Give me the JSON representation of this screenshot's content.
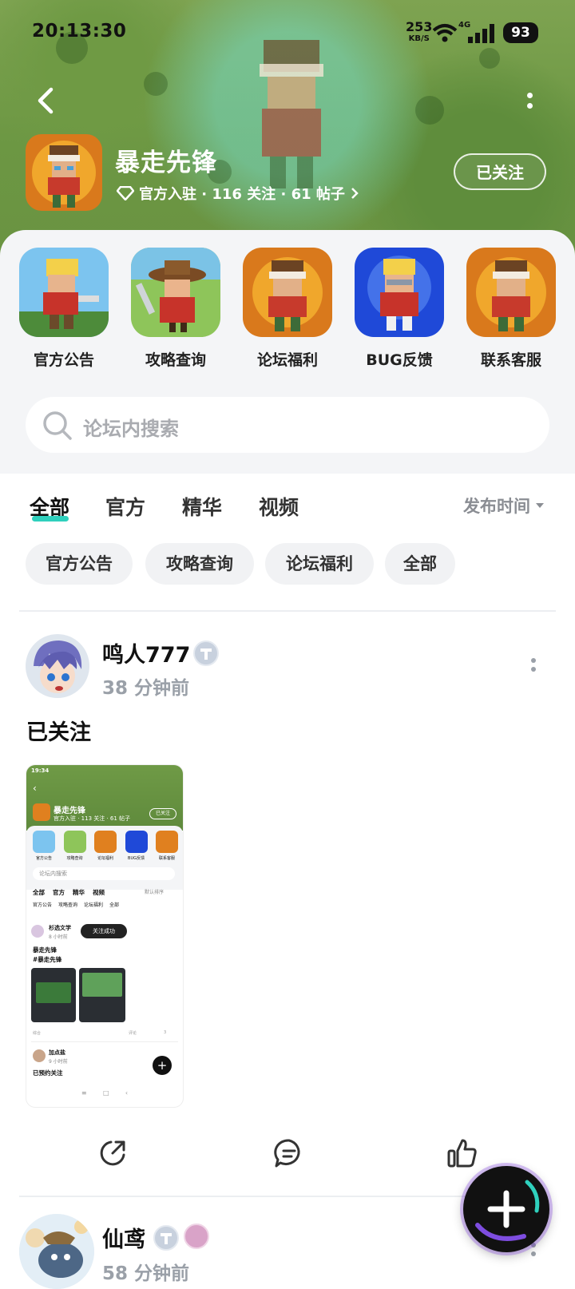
{
  "status_bar": {
    "time": "20:13:30",
    "net_speed_value": "253",
    "net_speed_unit": "KB/S",
    "network": "4G",
    "battery": "93"
  },
  "header": {
    "game_title": "暴走先锋",
    "meta_text": "官方入驻 · 116 关注 · 61 帖子",
    "follow_label": "已关注",
    "icons": {
      "back": "back-arrow-icon",
      "more": "vertical-dots-icon",
      "verified": "diamond-icon"
    }
  },
  "shortcuts": [
    {
      "label": "官方公告",
      "color": "#3aa0e0"
    },
    {
      "label": "攻略查询",
      "color": "#8cc056"
    },
    {
      "label": "论坛福利",
      "color": "#e07a1e"
    },
    {
      "label": "BUG反馈",
      "color": "#1f49d8"
    },
    {
      "label": "联系客服",
      "color": "#e07a1e"
    }
  ],
  "search": {
    "placeholder": "论坛内搜索"
  },
  "tabs": [
    {
      "label": "全部",
      "active": true
    },
    {
      "label": "官方"
    },
    {
      "label": "精华"
    },
    {
      "label": "视频"
    }
  ],
  "sort_label": "发布时间",
  "chips": [
    "官方公告",
    "攻略查询",
    "论坛福利",
    "全部"
  ],
  "post1": {
    "username": "鸣人777",
    "time": "38 分钟前",
    "text": "已关注",
    "screenshot": {
      "status_time": "19:34",
      "game_title": "暴走先锋",
      "meta_text": "官方入驻 · 113 关注 · 61 帖子",
      "follow_label": "已关注",
      "shortcuts": [
        "官方公告",
        "攻略查询",
        "论坛福利",
        "BUG反馈",
        "联系客服"
      ],
      "search_placeholder": "论坛内搜索",
      "tabs": [
        "全部",
        "官方",
        "精华",
        "视频"
      ],
      "sort_label": "默认排序",
      "chips": [
        "官方公告",
        "攻略查询",
        "论坛福利",
        "全部"
      ],
      "post_user": "杉选文学",
      "post_time": "8 小时前",
      "toast": "关注成功",
      "post_text_1": "暴走先锋",
      "post_text_2": "#暴走先锋",
      "footer_left": "综合",
      "comment_label": "评论",
      "like_count": "3",
      "post2_user": "加点盐",
      "post2_time": "9 小时前",
      "post2_text": "已预约关注"
    }
  },
  "post2": {
    "username": "仙鸢",
    "time": "58 分钟前"
  },
  "actions": {
    "share": "share-icon",
    "comment": "comment-icon",
    "like": "thumbs-up-icon",
    "fab": "plus-icon"
  }
}
